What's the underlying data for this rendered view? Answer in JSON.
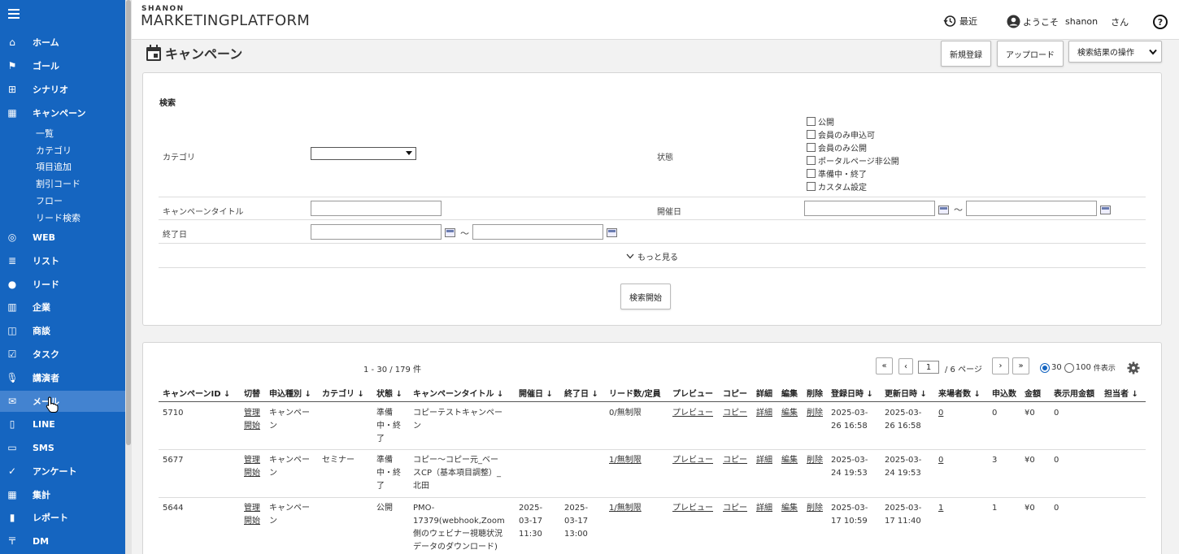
{
  "brand": {
    "small": "SHANON",
    "big": "MARKETINGPLATFORM"
  },
  "header": {
    "recent": "最近",
    "welcome": "ようこそ",
    "user": "shanon",
    "san": "さん",
    "help": "?"
  },
  "sidebar": {
    "items": [
      {
        "label": "ホーム",
        "icon": "home-icon"
      },
      {
        "label": "ゴール",
        "icon": "flag-icon"
      },
      {
        "label": "シナリオ",
        "icon": "scenario-icon"
      },
      {
        "label": "キャンペーン",
        "icon": "calendar-icon"
      },
      {
        "label": "WEB",
        "icon": "globe-icon"
      },
      {
        "label": "リスト",
        "icon": "list-icon"
      },
      {
        "label": "リード",
        "icon": "person-icon"
      },
      {
        "label": "企業",
        "icon": "building-icon"
      },
      {
        "label": "商談",
        "icon": "briefcase-icon"
      },
      {
        "label": "タスク",
        "icon": "task-icon"
      },
      {
        "label": "講演者",
        "icon": "mic-icon"
      },
      {
        "label": "メール",
        "icon": "mail-icon"
      },
      {
        "label": "LINE",
        "icon": "phone-icon"
      },
      {
        "label": "SMS",
        "icon": "sms-icon"
      },
      {
        "label": "アンケート",
        "icon": "check-icon"
      },
      {
        "label": "集計",
        "icon": "aggregate-icon"
      },
      {
        "label": "レポート",
        "icon": "report-icon"
      },
      {
        "label": "DM",
        "icon": "postmark-icon"
      }
    ],
    "sub_items": [
      "一覧",
      "カテゴリ",
      "項目追加",
      "割引コード",
      "フロー",
      "リード検索"
    ]
  },
  "page": {
    "title": "キャンペーン",
    "buttons": {
      "new": "新規登録",
      "upload": "アップロード",
      "ops": "検索結果の操作"
    }
  },
  "search": {
    "heading": "検索",
    "category_label": "カテゴリ",
    "status_label": "状態",
    "status_options": [
      "公開",
      "会員のみ申込可",
      "会員のみ公開",
      "ポータルページ非公開",
      "準備中・終了",
      "カスタム設定"
    ],
    "title_label": "キャンペーンタイトル",
    "date_label": "開催日",
    "end_label": "終了日",
    "tilde": "～",
    "more": "もっと見る",
    "start": "検索開始"
  },
  "results": {
    "range": "1 - 30 / 179 件",
    "page": "1",
    "pages": "/ 6 ページ",
    "opt30": "30",
    "opt100": "100",
    "display": "件表示",
    "columns": [
      "キャンペーンID ↓",
      "切替",
      "申込種別 ↓",
      "カテゴリ ↓",
      "状態 ↓",
      "キャンペーンタイトル ↓",
      "開催日 ↓",
      "終了日 ↓",
      "リード数/定員",
      "プレビュー",
      "コピー",
      "詳細",
      "編集",
      "削除",
      "登録日時 ↓",
      "更新日時 ↓",
      "来場者数 ↓",
      "申込数",
      "金額",
      "表示用金額",
      "担当者 ↓"
    ],
    "rows": [
      {
        "id": "5710",
        "kanri": "管理",
        "kaishi": "開始",
        "type": "キャンペー\nン",
        "category": "",
        "status": "準備\n中・終\n了",
        "title": "コピーテストキャンペー\nン",
        "date": "",
        "end": "",
        "leads": "0/無制限",
        "preview": "プレビュー",
        "copy": "コピー",
        "detail": "詳細",
        "edit": "編集",
        "delete": "削除",
        "created": "2025-03-\n26 16:58",
        "updated": "2025-03-\n26 16:58",
        "visitors": "0",
        "apps": "0",
        "amount": "¥0",
        "display_amount": "0"
      },
      {
        "id": "5677",
        "kanri": "管理",
        "kaishi": "開始",
        "type": "キャンペー\nン",
        "category": "セミナー",
        "status": "準備\n中・終\n了",
        "title": "コピー～コピー元_ベー\nスCP（基本項目調整）_\n北田",
        "date": "",
        "end": "",
        "leads": "1/無制限",
        "preview": "プレビュー",
        "copy": "コピー",
        "detail": "詳細",
        "edit": "編集",
        "delete": "削除",
        "created": "2025-03-\n24 19:53",
        "updated": "2025-03-\n24 19:53",
        "visitors": "0",
        "apps": "3",
        "amount": "¥0",
        "display_amount": "0"
      },
      {
        "id": "5644",
        "kanri": "管理",
        "kaishi": "開始",
        "type": "キャンペー\nン",
        "category": "",
        "status": "公開",
        "title": "PMO-\n17379(webhook,Zoom\n側のウェビナー視聴状況\nデータのダウンロード)",
        "date": "2025-\n03-17\n11:30",
        "end": "2025-\n03-17\n13:00",
        "leads": "1/無制限",
        "preview": "プレビュー",
        "copy": "コピー",
        "detail": "詳細",
        "edit": "編集",
        "delete": "削除",
        "created": "2025-03-\n17 10:59",
        "updated": "2025-03-\n17 11:40",
        "visitors": "1",
        "apps": "1",
        "amount": "¥0",
        "display_amount": "0"
      }
    ]
  }
}
